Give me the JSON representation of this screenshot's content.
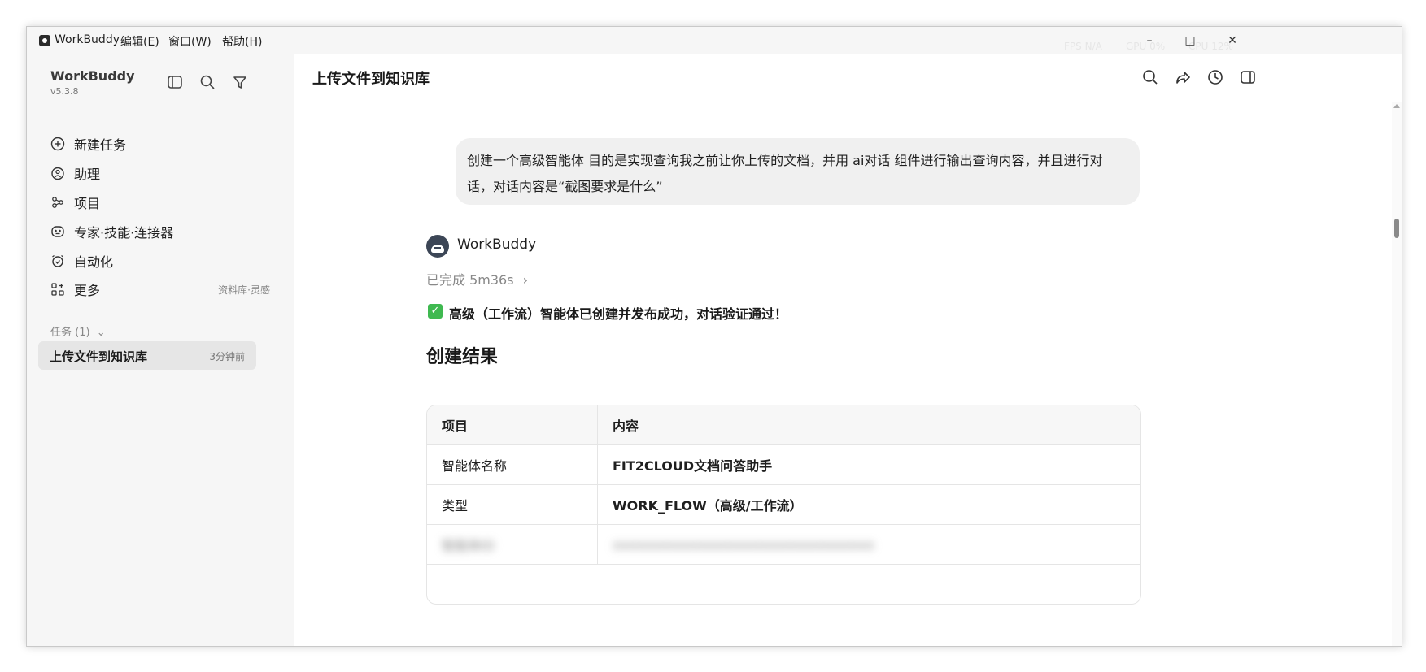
{
  "app": {
    "name": "WorkBuddy"
  },
  "menu": [
    "编辑(E)",
    "窗口(W)",
    "帮助(H)"
  ],
  "perf": {
    "fps": "FPS N/A",
    "gpu": "GPU 0%",
    "cpu": "CPU 12%"
  },
  "sidebar": {
    "title": "WorkBuddy",
    "version": "v5.3.8",
    "nav": [
      {
        "label": "新建任务",
        "icon": "plus-circle-icon"
      },
      {
        "label": "助理",
        "icon": "assistant-icon"
      },
      {
        "label": "项目",
        "icon": "project-icon"
      },
      {
        "label": "专家·技能·连接器",
        "icon": "expert-icon"
      },
      {
        "label": "自动化",
        "icon": "alarm-clock-icon"
      },
      {
        "label": "更多",
        "icon": "grid-plus-icon",
        "hint": "资料库·灵感"
      }
    ],
    "tasks_header": "任务 (1)",
    "tasks": [
      {
        "title": "上传文件到知识库",
        "time": "3分钟前"
      }
    ]
  },
  "main": {
    "title": "上传文件到知识库",
    "user_message": "创建一个高级智能体  目的是实现查询我之前让你上传的文档，并用 ai对话 组件进行输出查询内容，并且进行对话，对话内容是“截图要求是什么”",
    "bot_name": "WorkBuddy",
    "status": "已完成 5m36s",
    "success_text": "高级（工作流）智能体已创建并发布成功，对话验证通过！",
    "section_title": "创建结果",
    "table": {
      "headers": [
        "项目",
        "内容"
      ],
      "rows": [
        [
          "智能体名称",
          "FIT2CLOUD文档问答助手"
        ],
        [
          "类型",
          "WORK_FLOW（高级/工作流）"
        ],
        [
          "智能体ID",
          "xxxxxxxxxxxxxxxxxxxxxxxxxxxxxxxxxx"
        ]
      ]
    }
  }
}
